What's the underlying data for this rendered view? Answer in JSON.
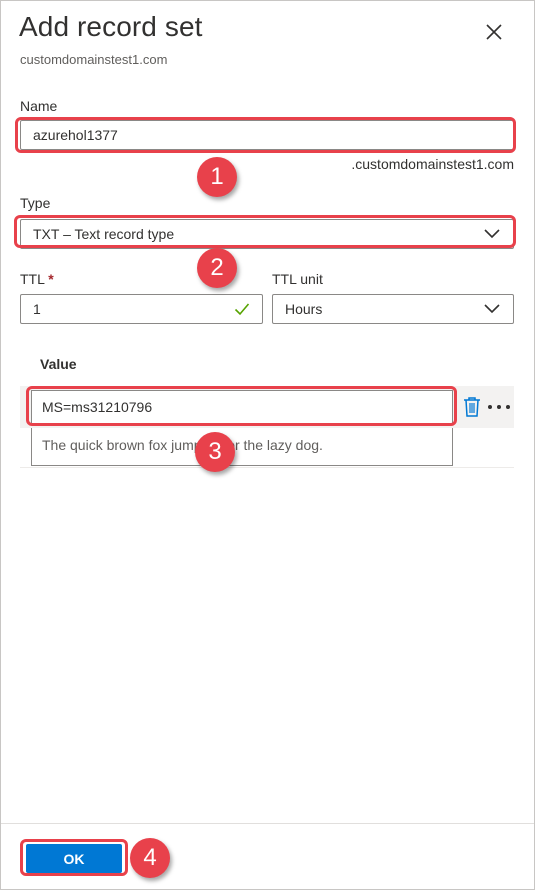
{
  "panel": {
    "title": "Add record set",
    "subtitle": "customdomainstest1.com"
  },
  "name": {
    "label": "Name",
    "value": "azurehol1377",
    "suffix": ".customdomainstest1.com"
  },
  "type": {
    "label": "Type",
    "selected": "TXT – Text record type"
  },
  "ttl": {
    "label": "TTL",
    "required_marker": "*",
    "value": "1"
  },
  "ttl_unit": {
    "label": "TTL unit",
    "selected": "Hours"
  },
  "value_table": {
    "header": "Value",
    "row_value": "MS=ms31210796",
    "new_row_placeholder": "The quick brown fox jumps over the lazy dog."
  },
  "footer": {
    "ok_label": "OK"
  },
  "callouts": [
    "1",
    "2",
    "3",
    "4"
  ],
  "colors": {
    "accent": "#0078d4",
    "highlight": "#e8414b",
    "valid_check": "#57a300",
    "required": "#a4262c"
  },
  "icons": [
    "close-icon",
    "check-icon",
    "chevron-down-icon",
    "trash-icon",
    "more-icon"
  ]
}
